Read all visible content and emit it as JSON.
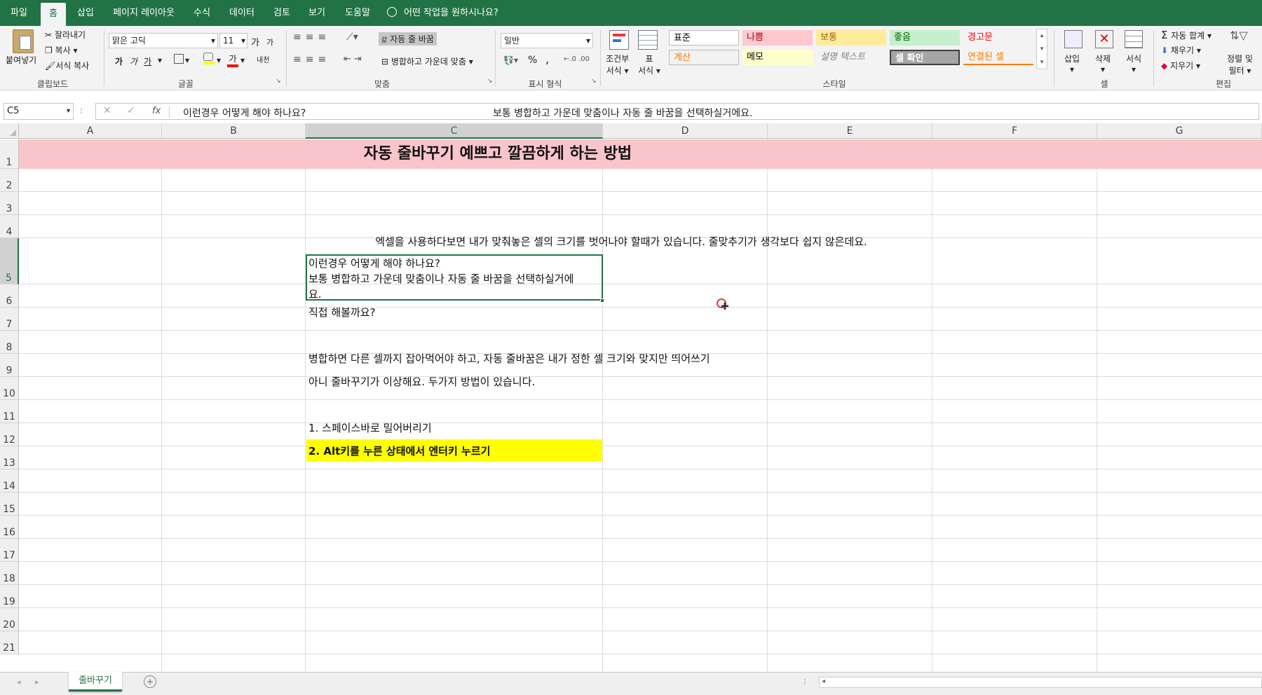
{
  "ribbon_tabs": [
    "파일",
    "홈",
    "삽입",
    "페이지 레이아웃",
    "수식",
    "데이터",
    "검토",
    "보기",
    "도움말"
  ],
  "active_tab": "홈",
  "tell_me": "어떤 작업을 원하시나요?",
  "clipboard": {
    "paste": "붙여넣기",
    "cut": "잘라내기",
    "copy": "복사",
    "format_painter": "서식 복사",
    "label": "클립보드"
  },
  "font": {
    "name": "맑은 고딕",
    "size": "11",
    "grow": "가",
    "shrink": "가",
    "bold": "가",
    "italic": "가",
    "underline": "가",
    "color_letter": "가",
    "phonetic": "내천",
    "label": "글꼴"
  },
  "alignment": {
    "wrap": "자동 줄 바꿈",
    "merge": "병합하고 가운데 맞춤",
    "label": "맞춤",
    "wrap_icon": "갊"
  },
  "number": {
    "format": "일반",
    "percent": "%",
    "comma": ",",
    "label": "표시 형식"
  },
  "styles_group": {
    "conditional": "조건부",
    "conditional2": "서식",
    "table": "표",
    "table2": "서식",
    "label": "스타일",
    "cells": [
      {
        "name": "표준",
        "bg": "#ffffff",
        "color": "#000000"
      },
      {
        "name": "나쁨",
        "bg": "#ffc7ce",
        "color": "#9c0006"
      },
      {
        "name": "보통",
        "bg": "#ffeb9c",
        "color": "#9c6500"
      },
      {
        "name": "좋음",
        "bg": "#c6efce",
        "color": "#006100"
      },
      {
        "name": "경고문",
        "bg": "#f3f3f3",
        "color": "#ff0000"
      },
      {
        "name": "계산",
        "bg": "#f2f2f2",
        "color": "#fa7d00"
      },
      {
        "name": "메모",
        "bg": "#ffffcc",
        "color": "#000000"
      },
      {
        "name": "설명 텍스트",
        "bg": "#f3f3f3",
        "color": "#7f7f7f"
      },
      {
        "name": "셀 확인",
        "bg": "#a5a5a5",
        "color": "#ffffff"
      },
      {
        "name": "연결된 셀",
        "bg": "#f3f3f3",
        "color": "#fa7d00"
      }
    ]
  },
  "cells_group": {
    "insert": "삽입",
    "delete": "삭제",
    "format": "서식",
    "label": "셀"
  },
  "editing": {
    "autosum": "자동 합계",
    "fill": "채우기",
    "clear": "지우기",
    "sort": "정렬 및",
    "sort2": "필터",
    "label": "편집"
  },
  "formula_bar": {
    "namebox": "C5",
    "line1": "이런경우 어떻게 해야 하나요?",
    "line2": "보통 병합하고 가운데 맞춤이나 자동 줄 바꿈을 선택하실거에요."
  },
  "columns": [
    "A",
    "B",
    "C",
    "D",
    "E",
    "F",
    "G"
  ],
  "rows": [
    "1",
    "2",
    "3",
    "4",
    "5",
    "6",
    "7",
    "8",
    "9",
    "10",
    "11",
    "12",
    "13",
    "14",
    "15",
    "16",
    "17",
    "18",
    "19",
    "20",
    "21"
  ],
  "sheet": {
    "title": "자동 줄바꾸기 예쁘고 깔끔하게 하는 방법",
    "r4": "엑셀을 사용하다보면 내가 맞춰놓은 셀의 크기를 벗어나야 할때가 있습니다. 줄맞추기가 생각보다 쉽지 않은데요.",
    "r5a": "이런경우 어떻게 해야 하나요?",
    "r5b": "보통 병합하고 가운데 맞춤이나 자동 줄 바꿈을 선택하실거에",
    "r5c": "요.",
    "r6": "직접 해볼까요?",
    "r8": "병합하면 다른 셀까지 잡아먹어야 하고, 자동 줄바꿈은 내가 정한 셀 크기와 맞지만 띄어쓰기",
    "r9": "아니 줄바꾸기가 이상해요. 두가지 방법이 있습니다.",
    "r11": "1. 스페이스바로 밀어버리기",
    "r12": "2. Alt키를 누른 상태에서 엔터키 누르기"
  },
  "sheet_tab": "줄바꾸기",
  "colors": {
    "accent": "#217346",
    "title_bg": "#f8c5cb",
    "highlight": "#ffff00"
  }
}
